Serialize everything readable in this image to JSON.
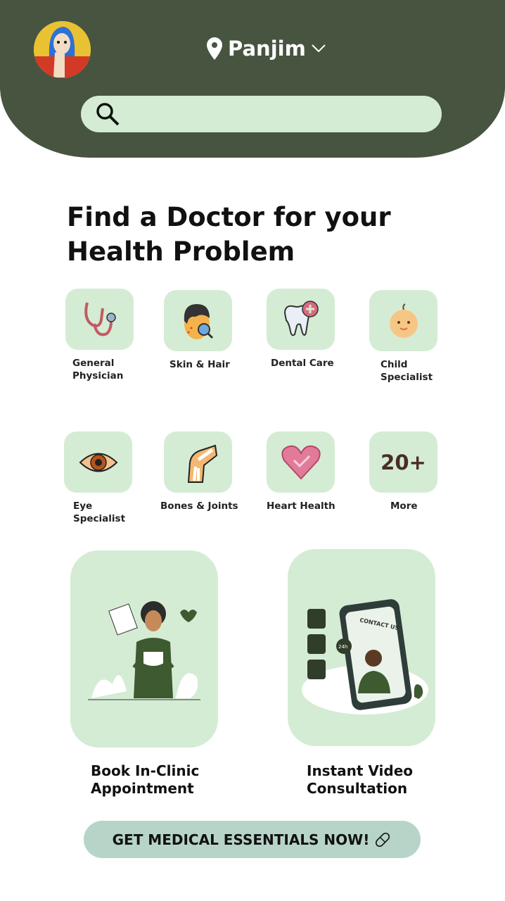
{
  "header": {
    "location": "Panjim",
    "search_placeholder": "",
    "bg_color": "#475440",
    "search_color": "#d4ecd4"
  },
  "title": {
    "line1": "Find a Doctor for your",
    "line2": "Health Problem"
  },
  "categories": [
    {
      "label": "General Physician",
      "icon": "stethoscope-icon"
    },
    {
      "label": "Skin & Hair",
      "icon": "skin-icon"
    },
    {
      "label": "Dental Care",
      "icon": "tooth-icon"
    },
    {
      "label": "Child Specialist",
      "icon": "baby-icon"
    },
    {
      "label": "Eye Specialist",
      "icon": "eye-icon"
    },
    {
      "label": "Bones & Joints",
      "icon": "knee-joint-icon"
    },
    {
      "label": "Heart Health",
      "icon": "heart-icon"
    },
    {
      "label": "More",
      "icon_text": "20+"
    }
  ],
  "cards": [
    {
      "label_line1": "Book In-Clinic",
      "label_line2": "Appointment"
    },
    {
      "label_line1": "Instant Video",
      "label_line2": "Consultation",
      "illustration_text": "CONTACT US",
      "badge": "24h"
    }
  ],
  "cta": {
    "label": "GET MEDICAL ESSENTIALS NOW!",
    "color": "#b7d4c8"
  }
}
